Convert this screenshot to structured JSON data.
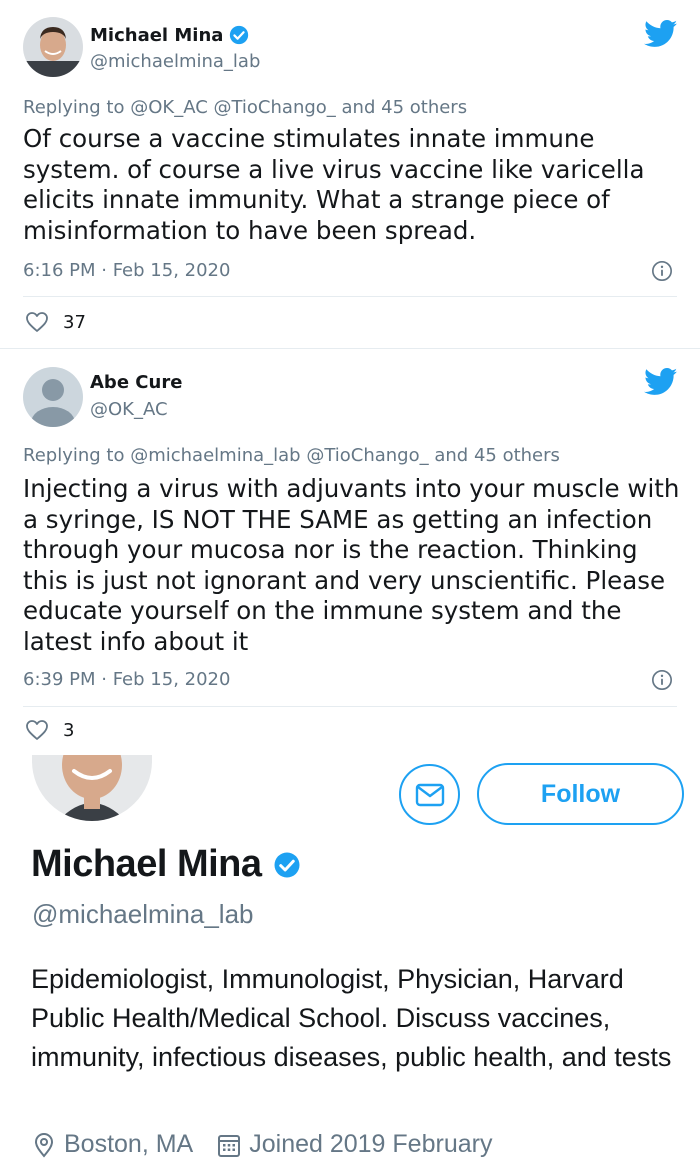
{
  "tweets": [
    {
      "author": "Michael Mina",
      "handle": "@michaelmina_lab",
      "verified": true,
      "reply_prefix": "Replying to",
      "reply_mentions": "@OK_AC @TioChango_",
      "reply_suffix": "and 45 others",
      "text": "Of course a vaccine stimulates innate immune system. of course a live virus vaccine like varicella elicits  innate immunity. What a strange piece of misinformation to have been spread.",
      "timestamp": "6:16 PM · Feb 15, 2020",
      "likes": "37"
    },
    {
      "author": "Abe Cure",
      "handle": "@OK_AC",
      "verified": false,
      "reply_prefix": "Replying to",
      "reply_mentions": "@michaelmina_lab @TioChango_",
      "reply_suffix": "and 45 others",
      "text": "Injecting a virus with adjuvants into your muscle with a syringe, IS NOT THE SAME as getting an infection through your mucosa nor is the reaction. Thinking this is just not ignorant and very unscientific.  Please educate yourself on the immune system and the latest info about it",
      "timestamp": "6:39 PM · Feb 15, 2020",
      "likes": "3"
    }
  ],
  "profile": {
    "name": "Michael Mina",
    "handle": "@michaelmina_lab",
    "follow_label": "Follow",
    "bio": "Epidemiologist, Immunologist, Physician, Harvard Public Health/Medical School. Discuss vaccines, immunity, infectious diseases, public health, and tests",
    "location": "Boston, MA",
    "joined": "Joined 2019 February"
  },
  "colors": {
    "accent": "#1da1f2",
    "secondary_text": "#657786",
    "primary_text": "#14171a"
  }
}
